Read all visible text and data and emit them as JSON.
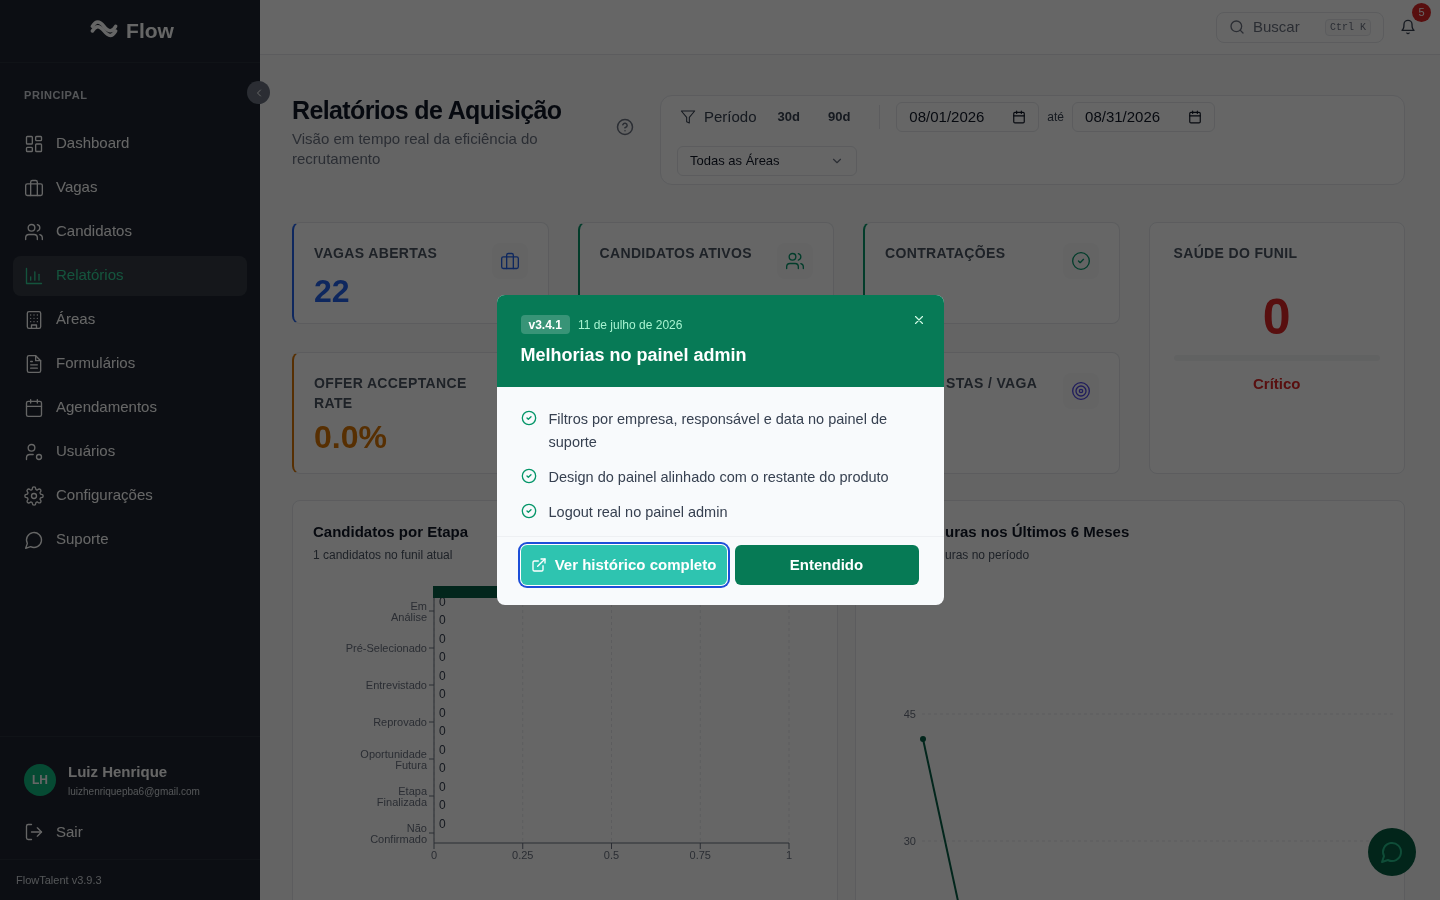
{
  "sidebar": {
    "logo": "Flow",
    "section": "PRINCIPAL",
    "items": [
      {
        "label": "Dashboard",
        "selected": false
      },
      {
        "label": "Vagas",
        "selected": false
      },
      {
        "label": "Candidatos",
        "selected": false
      },
      {
        "label": "Relatórios",
        "selected": true
      },
      {
        "label": "Áreas",
        "selected": false
      },
      {
        "label": "Formulários",
        "selected": false
      },
      {
        "label": "Agendamentos",
        "selected": false
      },
      {
        "label": "Usuários",
        "selected": false
      },
      {
        "label": "Configurações",
        "selected": false
      },
      {
        "label": "Suporte",
        "selected": false
      }
    ],
    "user": {
      "initials": "LH",
      "name": "Luiz Henrique",
      "email": "luizhenriquepba6@gmail.com"
    },
    "logout": "Sair",
    "version": "FlowTalent v3.9.3"
  },
  "topbar": {
    "search": {
      "label": "Buscar",
      "shortcut": "Ctrl K"
    },
    "notifications": "5"
  },
  "page": {
    "title": "Relatórios de Aquisição",
    "subtitle": "Visão em tempo real da eficiência do recrutamento"
  },
  "filters": {
    "label": "Período",
    "presets": [
      {
        "label": "30d",
        "selected": false
      },
      {
        "label": "90d",
        "selected": false
      }
    ],
    "date_from": "08/01/2026",
    "separator": "até",
    "date_to": "08/31/2026",
    "area": "Todas as Áreas"
  },
  "kpis": [
    {
      "label": "VAGAS ABERTAS",
      "value": "22"
    },
    {
      "label": "CANDIDATOS ATIVOS"
    },
    {
      "label": "CONTRATAÇÕES"
    },
    {
      "label": "OFFER ACCEPTANCE RATE",
      "value": "0.0%"
    },
    {
      "label": "STAS / VAGA"
    }
  ],
  "health": {
    "label": "SAÚDE DO FUNIL",
    "value": "0",
    "status": "Crítico",
    "level": 0
  },
  "charts": [
    {
      "title": "Candidatos por Etapa",
      "subtitle": "1 candidatos no funil atual",
      "chart_data": {
        "type": "bar",
        "orientation": "horizontal",
        "categories": [
          "Em Análise",
          "Pré-Selecionado",
          "Entrevistado",
          "Reprovado",
          "Oportunidade Futura",
          "Etapa Finalizada",
          "Não Confirmado"
        ],
        "series": [
          {
            "values": [
              0,
              0,
              0,
              0,
              0,
              0,
              0
            ]
          },
          {
            "values": [
              0,
              0,
              0,
              0,
              0,
              0,
              null
            ]
          }
        ],
        "xticks": [
          0,
          0.25,
          0.5,
          0.75,
          1
        ],
        "xlim": [
          0,
          1
        ],
        "grid": true,
        "data_labels": true
      }
    },
    {
      "title": "uras nos Últimos 6 Meses",
      "subtitle": "uras no período",
      "axis_labels": [
        "45",
        "30"
      ]
    }
  ],
  "modal": {
    "version": "v3.4.1",
    "date": "11 de julho de 2026",
    "title": "Melhorias no painel admin",
    "items": [
      "Filtros por empresa, responsável e data no painel de suporte",
      "Design do painel alinhado com o restante do produto",
      "Logout real no painel admin"
    ],
    "secondary": "Ver histórico completo",
    "primary": "Entendido"
  }
}
